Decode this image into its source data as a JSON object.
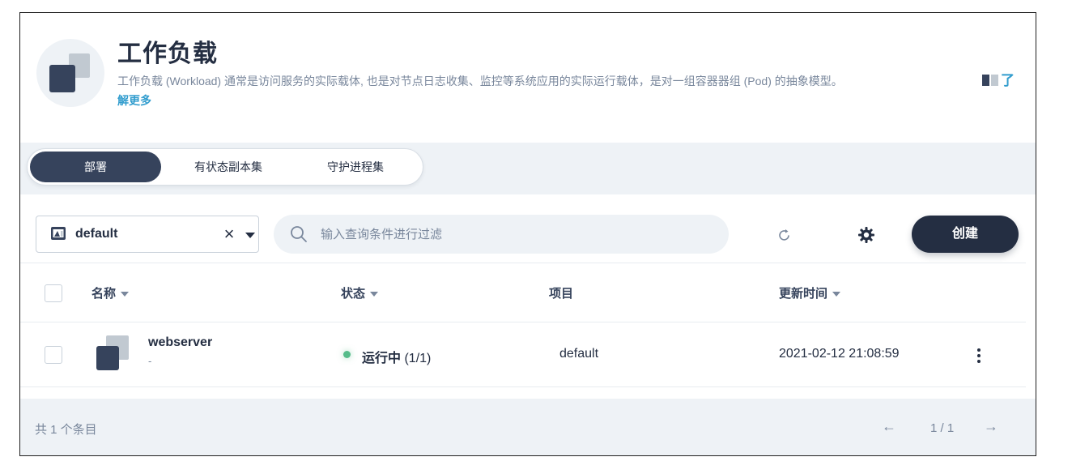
{
  "header": {
    "title": "工作负载",
    "description": "工作负载 (Workload) 通常是访问服务的实际载体, 也是对节点日志收集、监控等系统应用的实际运行载体，是对一组容器器组 (Pod) 的抽象模型。",
    "learn_more_part1": "了",
    "learn_more_part2": "解更多",
    "icon": "workload-icon"
  },
  "tabs": [
    {
      "label": "部署",
      "active": true
    },
    {
      "label": "有状态副本集",
      "active": false
    },
    {
      "label": "守护进程集",
      "active": false
    }
  ],
  "toolbar": {
    "namespace_value": "default",
    "namespace_clear": "×",
    "search_placeholder": "输入查询条件进行过滤",
    "create_label": "创建"
  },
  "table": {
    "columns": [
      "名称",
      "状态",
      "项目",
      "更新时间"
    ],
    "rows": [
      {
        "name": "webserver",
        "description": "-",
        "status": "运行中",
        "status_count": "(1/1)",
        "status_color": "#55bc8a",
        "project": "default",
        "updated": "2021-02-12 21:08:59"
      }
    ]
  },
  "footer": {
    "total": "共 1 个条目",
    "prev": "←",
    "page": "1 / 1",
    "next": "→"
  },
  "colors": {
    "primary_dark": "#242e42",
    "accent_blue": "#329dce",
    "running_green": "#55bc8a",
    "surface_gray": "#eef2f6"
  }
}
